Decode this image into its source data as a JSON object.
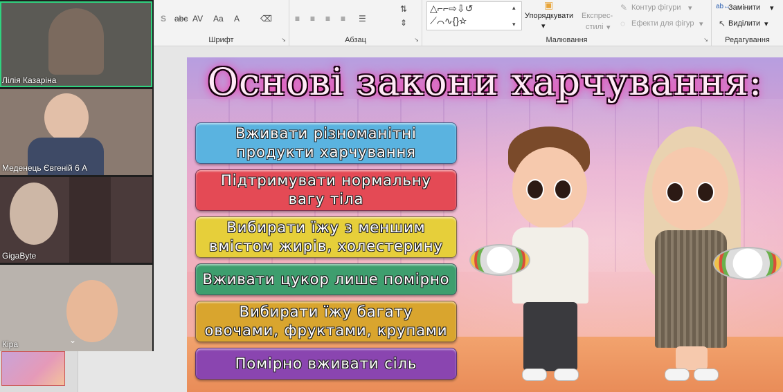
{
  "ribbon": {
    "groups": {
      "font": "Шрифт",
      "paragraph": "Абзац",
      "drawing": "Малювання",
      "editing": "Редагування"
    },
    "font_tools": {
      "s": "S",
      "abc": "abc",
      "av": "AV",
      "aa": "Aa",
      "a": "A"
    },
    "arrange_label": "Упорядкувати",
    "quick_styles_line1": "Експрес-",
    "quick_styles_line2": "стилі",
    "shape_outline": "Контур фігури",
    "shape_effects": "Ефекти для фігур",
    "replace": "Замінити",
    "select": "Виділити",
    "chevron": "▾"
  },
  "slide": {
    "title": "Основі закони харчування:",
    "rules": [
      {
        "text": "Вживати різноманітні продукти харчування",
        "color": "#5ab3e0"
      },
      {
        "text": "Підтримувати нормальну вагу тіла",
        "color": "#e44a55"
      },
      {
        "text": "Вибирати їжу з меншим вмістом жирів, холестерину",
        "color": "#e6cf3a"
      },
      {
        "text": "Вживати цукор лише помірно",
        "color": "#3e9e6e"
      },
      {
        "text": "Вибирати їжу багату овочами, фруктами, крупами",
        "color": "#d9a52e"
      },
      {
        "text": "Помірно вживати сіль",
        "color": "#8a45b0"
      }
    ]
  },
  "video": {
    "participants": [
      {
        "name": "Лілія Казаріна",
        "bg": "#5b5a55"
      },
      {
        "name": "Меденець Євгеній 6 А",
        "bg": "#8a7a70"
      },
      {
        "name": "GigaByte",
        "bg": "#4a3a3a"
      },
      {
        "name": "Кіра",
        "bg": "#b9b3ad"
      }
    ],
    "expand": "⌄"
  }
}
